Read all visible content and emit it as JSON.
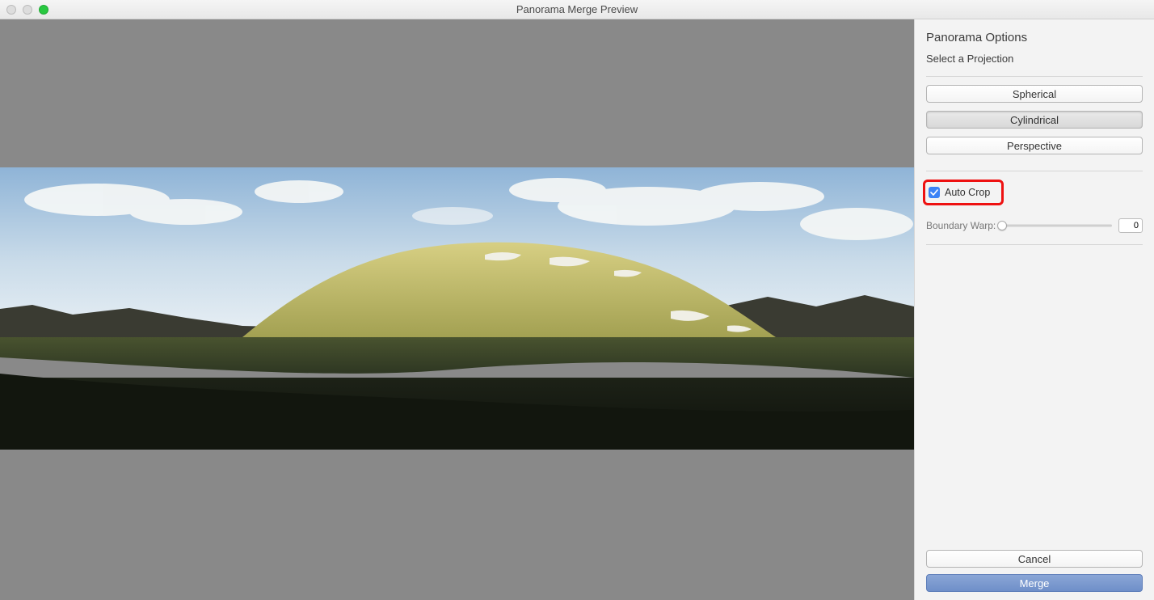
{
  "window": {
    "title": "Panorama Merge Preview"
  },
  "panel": {
    "title": "Panorama Options",
    "subtitle": "Select a Projection",
    "projections": {
      "spherical": "Spherical",
      "cylindrical": "Cylindrical",
      "perspective": "Perspective",
      "selected": "Cylindrical"
    },
    "autoCrop": {
      "label": "Auto Crop",
      "checked": true
    },
    "boundaryWarp": {
      "label": "Boundary Warp:",
      "value": "0"
    },
    "buttons": {
      "cancel": "Cancel",
      "merge": "Merge"
    }
  },
  "highlight": {
    "target": "auto-crop-checkbox"
  }
}
